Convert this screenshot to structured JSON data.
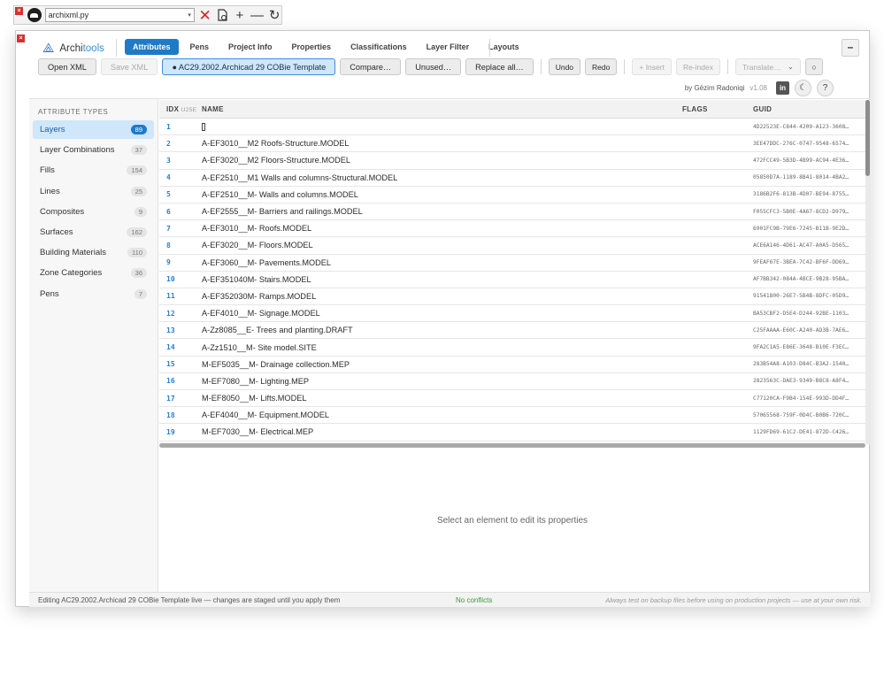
{
  "palette": {
    "close_label": "×",
    "file": "archixml.py",
    "tools": [
      "run-cancel",
      "reload",
      "add",
      "remove",
      "refresh"
    ]
  },
  "brand": {
    "name_a": "Archi",
    "name_b": "tools",
    "accent": "#3b8fe0"
  },
  "tabs": [
    "Attributes",
    "Pens",
    "Project Info",
    "Properties",
    "Classifications",
    "Layer Filter",
    "Layouts"
  ],
  "window": {
    "minimize_label": "–",
    "close_label": "×"
  },
  "toolbar": {
    "open_xml": "Open XML",
    "save_xml": "Save XML",
    "template": "● AC29.2002.Archicad 29 COBie Template",
    "compare": "Compare…",
    "unused": "Unused…",
    "replace_all": "Replace all…",
    "undo": "Undo",
    "redo": "Redo",
    "insert": "+ Insert",
    "reindex": "Re-index",
    "translate": "Translate…",
    "circle": "○"
  },
  "byline": {
    "author": "by Gëzim Radoniqi",
    "version": "v1.08",
    "linkedin": "in",
    "theme": "☾",
    "help": "?"
  },
  "sidebar": {
    "title": "ATTRIBUTE TYPES",
    "items": [
      {
        "label": "Layers",
        "count": "89"
      },
      {
        "label": "Layer Combinations",
        "count": "37"
      },
      {
        "label": "Fills",
        "count": "154"
      },
      {
        "label": "Lines",
        "count": "25"
      },
      {
        "label": "Composites",
        "count": "9"
      },
      {
        "label": "Surfaces",
        "count": "162"
      },
      {
        "label": "Building Materials",
        "count": "110"
      },
      {
        "label": "Zone Categories",
        "count": "36"
      },
      {
        "label": "Pens",
        "count": "7"
      }
    ]
  },
  "table": {
    "headers": {
      "idx": "IDX",
      "idx_sub": "U25E",
      "name": "NAME",
      "flags": "FLAGS",
      "guid": "GUID"
    },
    "rows": [
      {
        "idx": "1",
        "name": "",
        "guid": "4D22523E-C844-4209-A123-3608…"
      },
      {
        "idx": "2",
        "name": "A-EF3010__M2 Roofs-Structure.MODEL",
        "guid": "3EE47DDC-276C-0747-9548-6574…"
      },
      {
        "idx": "3",
        "name": "A-EF3020__M2 Floors-Structure.MODEL",
        "guid": "472FCC49-5B3D-4B99-AC94-4E36…"
      },
      {
        "idx": "4",
        "name": "A-EF2510__M1 Walls and columns-Structural.MODEL",
        "guid": "05850D7A-1189-8B41-8014-4BA2…"
      },
      {
        "idx": "5",
        "name": "A-EF2510__M- Walls and columns.MODEL",
        "guid": "3186B2F6-813B-4D07-BE94-8755…"
      },
      {
        "idx": "6",
        "name": "A-EF2555__M- Barriers and railings.MODEL",
        "guid": "F055CFC3-5B0E-4A67-8CD2-D979…"
      },
      {
        "idx": "7",
        "name": "A-EF3010__M- Roofs.MODEL",
        "guid": "6901FC9B-79E6-7245-B11B-9E2D…"
      },
      {
        "idx": "8",
        "name": "A-EF3020__M- Floors.MODEL",
        "guid": "ACE6A146-4D61-AC47-A0A5-D565…"
      },
      {
        "idx": "9",
        "name": "A-EF3060__M- Pavements.MODEL",
        "guid": "9FEAF67E-3BEA-7C42-BF6F-DD69…"
      },
      {
        "idx": "10",
        "name": "A-EF351040M- Stairs.MODEL",
        "guid": "AF7BB342-084A-4BCE-9B28-95BA…"
      },
      {
        "idx": "11",
        "name": "A-EF352030M- Ramps.MODEL",
        "guid": "91541800-26E7-5B4B-8DFC-05D9…"
      },
      {
        "idx": "12",
        "name": "A-EF4010__M- Signage.MODEL",
        "guid": "BA53CBF2-D5E4-D244-92BE-1103…"
      },
      {
        "idx": "13",
        "name": "A-Zz8085__E- Trees and planting.DRAFT",
        "guid": "C25FAAAA-E60C-A240-AD3B-7AE6…"
      },
      {
        "idx": "14",
        "name": "A-Zz1510__M- Site model.SITE",
        "guid": "9FA2C1A5-E86E-3648-B10E-F3EC…"
      },
      {
        "idx": "15",
        "name": "M-EF5035__M- Drainage collection.MEP",
        "guid": "283B54A8-A103-D84C-B3A2-1540…"
      },
      {
        "idx": "16",
        "name": "M-EF7080__M- Lighting.MEP",
        "guid": "2823563C-DAE3-9349-B8C8-A8F4…"
      },
      {
        "idx": "17",
        "name": "M-EF8050__M- Lifts.MODEL",
        "guid": "C77120CA-F9B4-154E-993D-DD4F…"
      },
      {
        "idx": "18",
        "name": "A-EF4040__M- Equipment.MODEL",
        "guid": "57065568-759F-0D4C-B0B6-720C…"
      },
      {
        "idx": "19",
        "name": "M-EF7030__M- Electrical.MEP",
        "guid": "1129FD69-61C2-DE41-872D-C426…"
      }
    ]
  },
  "detail": {
    "empty_message": "Select an element to edit its properties"
  },
  "status": {
    "left": "Editing AC29.2002.Archicad 29 COBie Template live — changes are staged until you apply them",
    "middle": "No conflicts",
    "right": "Always test on backup files before using on production projects — use at your own risk."
  }
}
